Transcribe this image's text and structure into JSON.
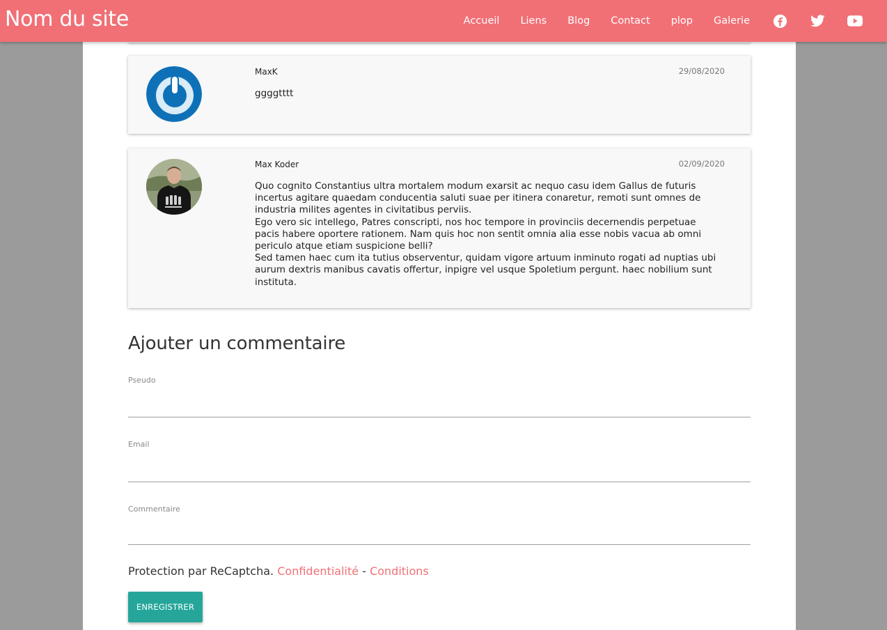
{
  "header": {
    "site_title": "Nom du site",
    "nav": [
      "Accueil",
      "Liens",
      "Blog",
      "Contact",
      "plop",
      "Galerie"
    ],
    "social_icons": [
      "facebook-icon",
      "twitter-icon",
      "youtube-icon"
    ],
    "color": "#f07076"
  },
  "comments": [
    {
      "author": "MaxK",
      "date": "29/08/2020",
      "text": "ggggtttt",
      "avatar": "power-logo-avatar"
    },
    {
      "author": "Max Koder",
      "date": "02/09/2020",
      "text_lines": [
        "Quo cognito Constantius ultra mortalem modum exarsit ac nequo casu idem Gallus de futuris incertus agitare quaedam conducentia saluti suae per itinera conaretur, remoti sunt omnes de industria milites agentes in civitatibus perviis.",
        "Ego vero sic intellego, Patres conscripti, nos hoc tempore in provinciis decernendis perpetuae pacis habere oportere rationem. Nam quis hoc non sentit omnia alia esse nobis vacua ab omni periculo atque etiam suspicione belli?",
        "Sed tamen haec cum ita tutius observentur, quidam vigore artuum inminuto rogati ad nuptias ubi aurum dextris manibus cavatis offertur, inpigre vel usque Spoletium pergunt. haec nobilium sunt instituta."
      ],
      "avatar": "person-photo-avatar"
    }
  ],
  "form": {
    "title": "Ajouter un commentaire",
    "pseudo_label": "Pseudo",
    "email_label": "Email",
    "comment_label": "Commentaire",
    "pseudo_value": "",
    "email_value": "",
    "comment_value": "",
    "recaptcha_text": "Protection par ReCaptcha.",
    "privacy_link": "Confidentialité",
    "separator": "-",
    "terms_link": "Conditions",
    "submit_label": "ENREGISTRER",
    "button_color": "#26a69a"
  }
}
